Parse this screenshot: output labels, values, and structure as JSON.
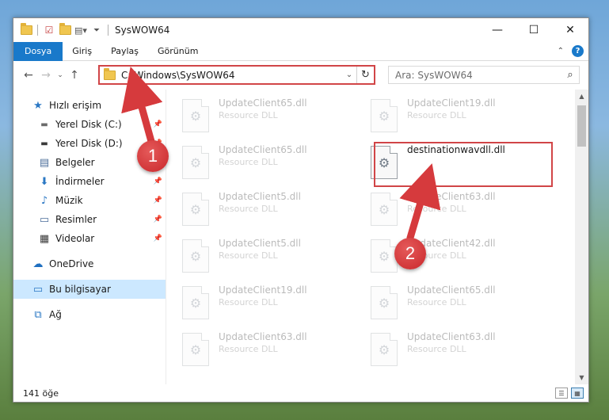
{
  "window": {
    "title": "SysWOW64",
    "controls": {
      "minimize": "—",
      "maximize": "☐",
      "close": "✕"
    }
  },
  "ribbon": {
    "tabs": [
      {
        "label": "Dosya",
        "active": true
      },
      {
        "label": "Giriş",
        "active": false
      },
      {
        "label": "Paylaş",
        "active": false
      },
      {
        "label": "Görünüm",
        "active": false
      }
    ],
    "help": "?",
    "collapse": "⌃"
  },
  "nav": {
    "back": "←",
    "forward": "→",
    "recent": "⌄",
    "up": "↑"
  },
  "address": {
    "path": "C:\\Windows\\SysWOW64",
    "chevron": "⌄",
    "refresh": "↻"
  },
  "search": {
    "placeholder": "Ara: SysWOW64",
    "icon": "⌕"
  },
  "sidebar": {
    "items": [
      {
        "label": "Hızlı erişim",
        "icon": "star-icon",
        "glyph": "★",
        "color": "#2b78c4",
        "pinned": false,
        "selected": false,
        "indent": false
      },
      {
        "label": "Yerel Disk (C:)",
        "icon": "drive-icon",
        "glyph": "▬",
        "color": "#6b6b6b",
        "pinned": true,
        "selected": false,
        "indent": true
      },
      {
        "label": "Yerel Disk (D:)",
        "icon": "drive-icon",
        "glyph": "▬",
        "color": "#4a4a4a",
        "pinned": true,
        "selected": false,
        "indent": true
      },
      {
        "label": "Belgeler",
        "icon": "document-icon",
        "glyph": "▤",
        "color": "#4b6e9a",
        "pinned": true,
        "selected": false,
        "indent": true
      },
      {
        "label": "İndirmeler",
        "icon": "download-icon",
        "glyph": "⬇",
        "color": "#2b78c4",
        "pinned": true,
        "selected": false,
        "indent": true
      },
      {
        "label": "Müzik",
        "icon": "music-icon",
        "glyph": "♪",
        "color": "#2b78c4",
        "pinned": true,
        "selected": false,
        "indent": true
      },
      {
        "label": "Resimler",
        "icon": "pictures-icon",
        "glyph": "▭",
        "color": "#4b6e9a",
        "pinned": true,
        "selected": false,
        "indent": true
      },
      {
        "label": "Videolar",
        "icon": "video-icon",
        "glyph": "▦",
        "color": "#3a3a3a",
        "pinned": true,
        "selected": false,
        "indent": true
      },
      {
        "label": "OneDrive",
        "icon": "onedrive-icon",
        "glyph": "☁",
        "color": "#1f6fc0",
        "pinned": false,
        "selected": false,
        "indent": false,
        "gap_before": true
      },
      {
        "label": "Bu bilgisayar",
        "icon": "computer-icon",
        "glyph": "▭",
        "color": "#2b78c4",
        "pinned": false,
        "selected": true,
        "indent": false,
        "gap_before": true
      },
      {
        "label": "Ağ",
        "icon": "network-icon",
        "glyph": "⧉",
        "color": "#2b78c4",
        "pinned": false,
        "selected": false,
        "indent": false,
        "gap_before": true
      }
    ]
  },
  "files": [
    {
      "name": "UpdateClient65.dll",
      "type": "Resource DLL"
    },
    {
      "name": "UpdateClient19.dll",
      "type": "Resource DLL"
    },
    {
      "name": "UpdateClient65.dll",
      "type": "Resource DLL"
    },
    {
      "name": "destinationwavdll.dll",
      "type": "",
      "highlighted": true
    },
    {
      "name": "UpdateClient5.dll",
      "type": "Resource DLL"
    },
    {
      "name": "UpdateClient63.dll",
      "type": "Resource DLL"
    },
    {
      "name": "UpdateClient5.dll",
      "type": "Resource DLL"
    },
    {
      "name": "UpdateClient42.dll",
      "type": "Resource DLL"
    },
    {
      "name": "UpdateClient19.dll",
      "type": "Resource DLL"
    },
    {
      "name": "UpdateClient65.dll",
      "type": "Resource DLL"
    },
    {
      "name": "UpdateClient63.dll",
      "type": "Resource DLL"
    },
    {
      "name": "UpdateClient63.dll",
      "type": "Resource DLL"
    }
  ],
  "status": {
    "count": "141 öğe"
  },
  "markers": {
    "one": "1",
    "two": "2"
  },
  "colors": {
    "accent": "#1979ca",
    "highlight": "#d14547",
    "selected": "#cce8ff"
  }
}
